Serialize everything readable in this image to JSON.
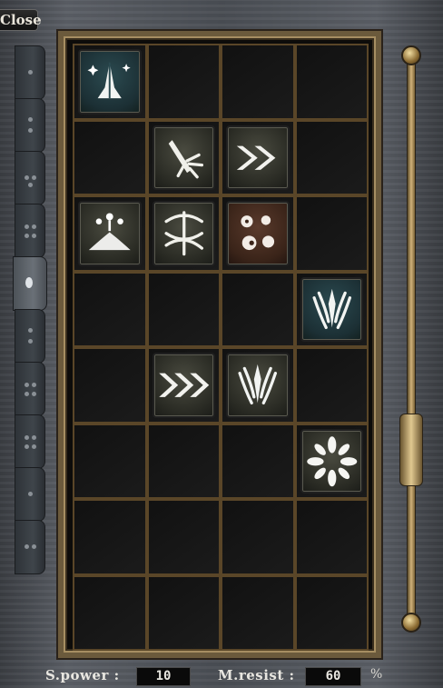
{
  "window": {
    "close_label": "Close"
  },
  "tabs": [
    {
      "name": "tab-1"
    },
    {
      "name": "tab-2"
    },
    {
      "name": "tab-3"
    },
    {
      "name": "tab-4"
    },
    {
      "name": "tab-5",
      "active": true
    },
    {
      "name": "tab-6"
    },
    {
      "name": "tab-7"
    },
    {
      "name": "tab-8"
    },
    {
      "name": "tab-9"
    },
    {
      "name": "tab-10"
    }
  ],
  "skill_grid": {
    "rows": 8,
    "cols": 4,
    "skills": [
      {
        "row": 0,
        "col": 0,
        "icon": "praying-hands-icon",
        "style": "teal"
      },
      {
        "row": 1,
        "col": 1,
        "icon": "spear-burst-icon",
        "style": "normal"
      },
      {
        "row": 1,
        "col": 2,
        "icon": "double-chevron-icon",
        "style": "normal"
      },
      {
        "row": 2,
        "col": 0,
        "icon": "eruption-icon",
        "style": "normal"
      },
      {
        "row": 2,
        "col": 1,
        "icon": "tangle-icon",
        "style": "normal"
      },
      {
        "row": 2,
        "col": 2,
        "icon": "boulders-icon",
        "style": "rust"
      },
      {
        "row": 3,
        "col": 3,
        "icon": "crest-icon",
        "style": "teal"
      },
      {
        "row": 4,
        "col": 1,
        "icon": "triple-chevron-icon",
        "style": "normal"
      },
      {
        "row": 4,
        "col": 2,
        "icon": "crest-icon",
        "style": "normal"
      },
      {
        "row": 5,
        "col": 3,
        "icon": "petal-burst-icon",
        "style": "normal"
      }
    ]
  },
  "stats": {
    "spower_label": "S.power :",
    "spower_value": "10",
    "mresist_label": "M.resist :",
    "mresist_value": "60",
    "mresist_unit": "%"
  },
  "colors": {
    "frame_gold": "#6b5a3c",
    "cell_border": "#5a4628",
    "stone": "#4a4e54"
  }
}
